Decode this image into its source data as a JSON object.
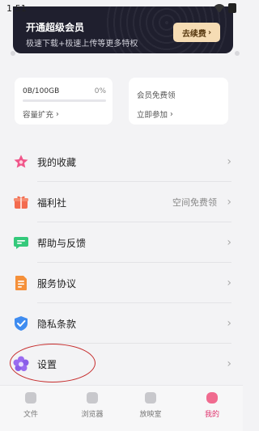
{
  "status_bar": {
    "time": "1:51"
  },
  "vip_banner": {
    "title": "开通超级会员",
    "subtitle": "极速下载+极速上传等更多特权",
    "renew_label": "去续费",
    "renew_chevron": "›"
  },
  "storage_card": {
    "usage": "0B/100GB",
    "percent": "0%",
    "usage_fraction": 0,
    "link_label": "容量扩充",
    "link_chevron": "›"
  },
  "member_card": {
    "title": "会员免费领",
    "link_label": "立即参加",
    "link_chevron": "›"
  },
  "menu": {
    "favorites": {
      "label": "我的收藏",
      "chevron": "›",
      "icon": "star-icon"
    },
    "benefits": {
      "label": "福利社",
      "extra": "空间免费领",
      "chevron": "›",
      "icon": "gift-icon"
    },
    "help": {
      "label": "帮助与反馈",
      "chevron": "›",
      "icon": "chat-icon"
    },
    "service": {
      "label": "服务协议",
      "chevron": "›",
      "icon": "document-icon"
    },
    "privacy": {
      "label": "隐私条款",
      "chevron": "›",
      "icon": "shield-icon"
    },
    "settings": {
      "label": "设置",
      "chevron": "›",
      "icon": "flower-settings-icon"
    }
  },
  "bottom_nav": {
    "files": "文件",
    "browser": "浏览器",
    "player": "放映室",
    "mine": "我的",
    "active": "我的"
  },
  "colors": {
    "banner_bg": "#1f1f2e",
    "renew_btn": "#f6dcb4",
    "active_tab": "#e0336e",
    "highlight_oval": "#c62b2b"
  }
}
